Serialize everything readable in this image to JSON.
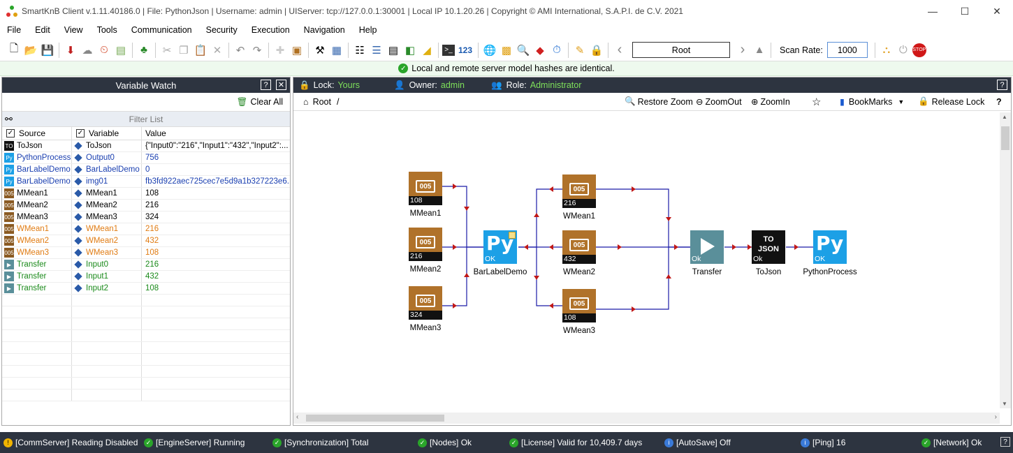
{
  "window": {
    "title": "SmartKnB Client v.1.11.40186.0  |  File: PythonJson  |  Username: admin  |  UIServer: tcp://127.0.0.1:30001  |  Local IP 10.1.20.26  |  Copyright ©  AMI International, S.A.P.I. de C.V. 2021"
  },
  "menu": [
    "File",
    "Edit",
    "View",
    "Tools",
    "Communication",
    "Security",
    "Execution",
    "Navigation",
    "Help"
  ],
  "toolbar": {
    "root_value": "Root",
    "scan_rate_label": "Scan Rate:",
    "scan_rate_value": "1000",
    "count_label": "123"
  },
  "notice": "Local and remote server model hashes are identical.",
  "variable_watch": {
    "title": "Variable Watch",
    "clear_all": "Clear All",
    "filter_placeholder": "Filter List",
    "col_source": "Source",
    "col_variable": "Variable",
    "col_value": "Value",
    "rows": [
      {
        "source": "ToJson",
        "variable": "ToJson",
        "value": "{\"Input0\":\"216\",\"Input1\":\"432\",\"Input2\":...",
        "color": "#000000",
        "value_color": "#000000",
        "src_icon": "tojson-icon"
      },
      {
        "source": "PythonProcess",
        "variable": "Output0",
        "value": "756",
        "color": "#1a3fb0",
        "value_color": "#1a3fb0",
        "src_icon": "python-icon"
      },
      {
        "source": "BarLabelDemo",
        "variable": "BarLabelDemo",
        "value": "0",
        "color": "#1a3fb0",
        "value_color": "#1a3fb0",
        "src_icon": "python-icon"
      },
      {
        "source": "BarLabelDemo",
        "variable": "img01",
        "value": "fb3fd922aec725cec7e5d9a1b327223e6...",
        "color": "#1a3fb0",
        "value_color": "#1a3fb0",
        "src_icon": "python-icon"
      },
      {
        "source": "MMean1",
        "variable": "MMean1",
        "value": "108",
        "color": "#000000",
        "value_color": "#000000",
        "src_icon": "mean-icon"
      },
      {
        "source": "MMean2",
        "variable": "MMean2",
        "value": "216",
        "color": "#000000",
        "value_color": "#000000",
        "src_icon": "mean-icon"
      },
      {
        "source": "MMean3",
        "variable": "MMean3",
        "value": "324",
        "color": "#000000",
        "value_color": "#000000",
        "src_icon": "mean-icon"
      },
      {
        "source": "WMean1",
        "variable": "WMean1",
        "value": "216",
        "color": "#e07b12",
        "value_color": "#e07b12",
        "src_icon": "mean-icon"
      },
      {
        "source": "WMean2",
        "variable": "WMean2",
        "value": "432",
        "color": "#e07b12",
        "value_color": "#e07b12",
        "src_icon": "mean-icon"
      },
      {
        "source": "WMean3",
        "variable": "WMean3",
        "value": "108",
        "color": "#e07b12",
        "value_color": "#e07b12",
        "src_icon": "mean-icon"
      },
      {
        "source": "Transfer",
        "variable": "Input0",
        "value": "216",
        "color": "#1a8a1a",
        "value_color": "#1a8a1a",
        "src_icon": "transfer-icon"
      },
      {
        "source": "Transfer",
        "variable": "Input1",
        "value": "432",
        "color": "#1a8a1a",
        "value_color": "#1a8a1a",
        "src_icon": "transfer-icon"
      },
      {
        "source": "Transfer",
        "variable": "Input2",
        "value": "108",
        "color": "#1a8a1a",
        "value_color": "#1a8a1a",
        "src_icon": "transfer-icon"
      }
    ]
  },
  "diagram_panel": {
    "lock_label": "Lock:",
    "lock_value": "Yours",
    "owner_label": "Owner:",
    "owner_value": "admin",
    "role_label": "Role:",
    "role_value": "Administrator",
    "breadcrumb": "Root",
    "breadcrumb_sep": "/",
    "restore_zoom": "Restore Zoom",
    "zoom_out": "ZoomOut",
    "zoom_in": "ZoomIn",
    "bookmarks": "BookMarks",
    "release_lock": "Release Lock"
  },
  "blocks": {
    "mmean1": {
      "name": "MMean1",
      "value": "108",
      "chip": "005"
    },
    "mmean2": {
      "name": "MMean2",
      "value": "216",
      "chip": "005"
    },
    "mmean3": {
      "name": "MMean3",
      "value": "324",
      "chip": "005"
    },
    "wmean1": {
      "name": "WMean1",
      "value": "216",
      "chip": "005"
    },
    "wmean2": {
      "name": "WMean2",
      "value": "432",
      "chip": "005"
    },
    "wmean3": {
      "name": "WMean3",
      "value": "108",
      "chip": "005"
    },
    "barlabel": {
      "name": "BarLabelDemo",
      "value": "OK",
      "glyph": "Py"
    },
    "transfer": {
      "name": "Transfer",
      "value": "Ok"
    },
    "tojson": {
      "name": "ToJson",
      "value": "Ok",
      "glyph": "TO JSON"
    },
    "python": {
      "name": "PythonProcess",
      "value": "OK",
      "glyph": "Py"
    }
  },
  "status": [
    {
      "text": "[CommServer] Reading Disabled",
      "kind": "warn"
    },
    {
      "text": "[EngineServer] Running",
      "kind": "ok"
    },
    {
      "text": "[Synchronization] Total",
      "kind": "ok"
    },
    {
      "text": "[Nodes] Ok",
      "kind": "ok"
    },
    {
      "text": "[License] Valid for 10,409.7 days",
      "kind": "ok"
    },
    {
      "text": "[AutoSave] Off",
      "kind": "info"
    },
    {
      "text": "[Ping] 16",
      "kind": "info"
    },
    {
      "text": "[Network] Ok",
      "kind": "ok"
    }
  ],
  "colors": {
    "panel_header": "#2d3440",
    "accent_green": "#7ee05a",
    "block_bronze": "#b0722a",
    "block_python": "#1ca0e6",
    "wire": "#1a1aa8",
    "arrow": "#c01818"
  }
}
